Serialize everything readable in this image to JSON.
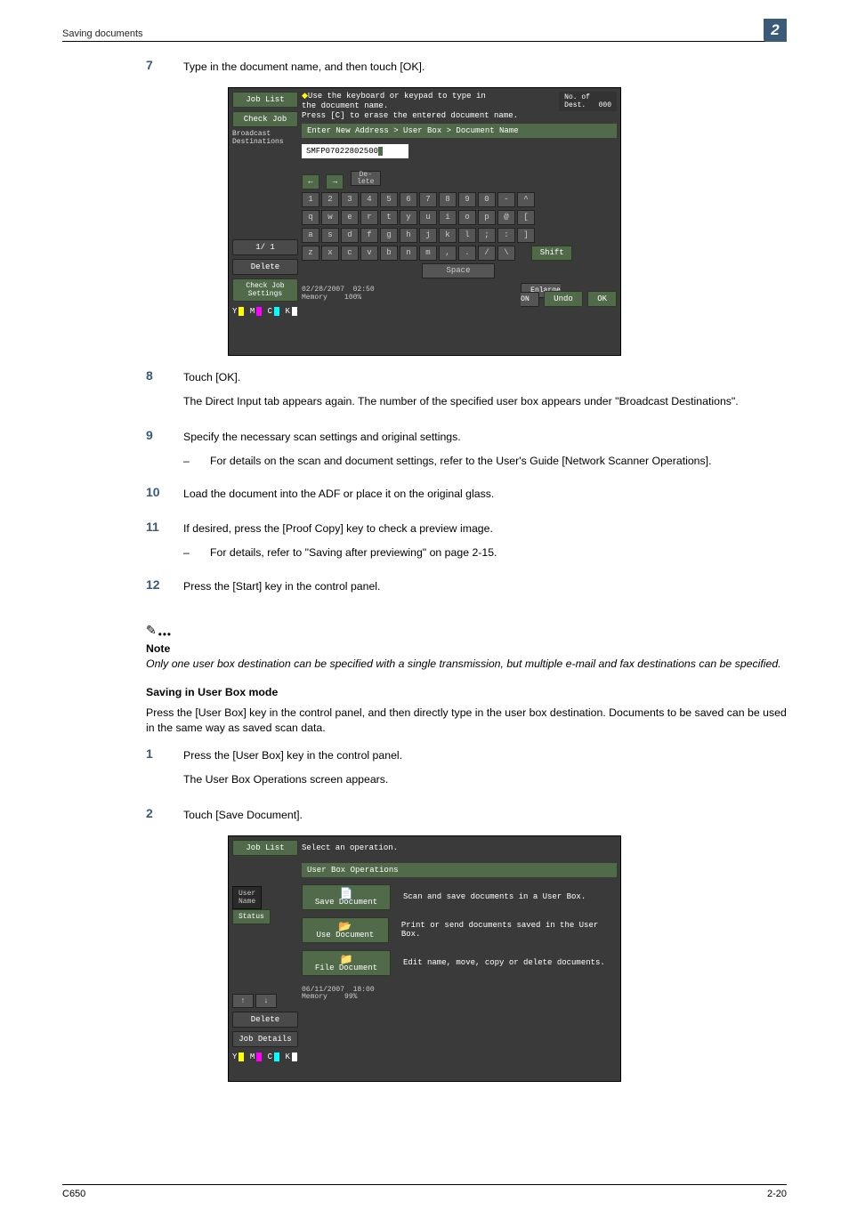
{
  "header": {
    "left": "Saving documents",
    "chapter": "2"
  },
  "footer": {
    "left": "C650",
    "right": "2-20"
  },
  "steps_a": {
    "s7": {
      "num": "7",
      "text": "Type in the document name, and then touch [OK]."
    },
    "s8": {
      "num": "8",
      "text": "Touch [OK].",
      "text2": "The Direct Input tab appears again. The number of the specified user box appears under \"Broadcast Destinations\"."
    },
    "s9": {
      "num": "9",
      "text": "Specify the necessary scan settings and original settings.",
      "sub": "For details on the scan and document settings, refer to the User's Guide [Network Scanner Operations]."
    },
    "s10": {
      "num": "10",
      "text": "Load the document into the ADF or place it on the original glass."
    },
    "s11": {
      "num": "11",
      "text": "If desired, press the [Proof Copy] key to check a preview image.",
      "sub": "For details, refer to \"Saving after previewing\" on page 2-15."
    },
    "s12": {
      "num": "12",
      "text": "Press the [Start] key in the control panel."
    }
  },
  "note": {
    "label": "Note",
    "text": "Only one user box destination can be specified with a single transmission, but multiple e-mail and fax destinations can be specified."
  },
  "section": {
    "heading": "Saving in User Box mode",
    "para": "Press the [User Box] key in the control panel, and then directly type in the user box destination. Documents to be saved can be used in the same way as saved scan data."
  },
  "steps_b": {
    "s1": {
      "num": "1",
      "text": "Press the [User Box] key in the control panel.",
      "text2": "The User Box Operations screen appears."
    },
    "s2": {
      "num": "2",
      "text": "Touch [Save Document]."
    }
  },
  "scr1": {
    "job_list": "Job List",
    "check_job": "Check Job",
    "broadcast": "Broadcast\nDestinations",
    "page": "1/  1",
    "delete": "Delete",
    "check_settings": "Check Job\nSettings",
    "msg1": "Use the keyboard or keypad to type in",
    "msg2": "the document name.",
    "msg3": "Press [C] to erase the entered document name.",
    "dest_label": "No. of\nDest.",
    "dest_val": "000",
    "bar": "Enter New Address > User Box > Document Name",
    "input": "SMFP07022802500",
    "delete_key": "De-\nlete",
    "row1": [
      "1",
      "2",
      "3",
      "4",
      "5",
      "6",
      "7",
      "8",
      "9",
      "0",
      "-",
      "^"
    ],
    "row2": [
      "q",
      "w",
      "e",
      "r",
      "t",
      "y",
      "u",
      "i",
      "o",
      "p",
      "@",
      "["
    ],
    "row3": [
      "a",
      "s",
      "d",
      "f",
      "g",
      "h",
      "j",
      "k",
      "l",
      ";",
      ":",
      "]"
    ],
    "row4": [
      "z",
      "x",
      "c",
      "v",
      "b",
      "n",
      "m",
      ",",
      ".",
      "/",
      "\\"
    ],
    "shift": "Shift",
    "space": "Space",
    "date": "02/28/2007",
    "time": "02:50",
    "mem_lbl": "Memory",
    "mem_val": "100%",
    "enlarge": "Enlarge\nON",
    "undo": "Undo",
    "ok": "OK"
  },
  "scr2": {
    "job_list": "Job List",
    "user_tab": "User\nName",
    "status_tab": "Status",
    "delete": "Delete",
    "job_details": "Job Details",
    "msg": "Select an operation.",
    "bar": "User Box Operations",
    "op1": {
      "btn": "Save Document",
      "desc": "Scan and save documents in a User Box."
    },
    "op2": {
      "btn": "Use Document",
      "desc": "Print or send documents saved in the User Box."
    },
    "op3": {
      "btn": "File Document",
      "desc": "Edit name, move, copy or delete documents."
    },
    "date": "06/11/2007",
    "time": "18:00",
    "mem_lbl": "Memory",
    "mem_val": "99%"
  }
}
